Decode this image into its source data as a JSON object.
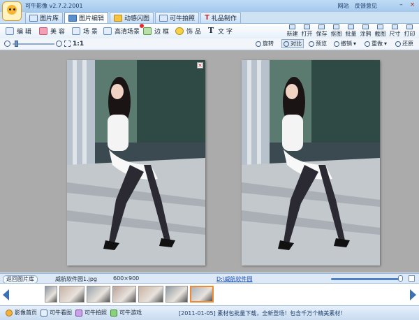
{
  "app": {
    "title": "可牛影像 v2.7.2.2001"
  },
  "header_links": [
    "网站",
    "反馈意见"
  ],
  "window_buttons": {
    "minimize": "–",
    "close": "×"
  },
  "tabs": [
    {
      "label": "图片库",
      "icon": "gallery-icon"
    },
    {
      "label": "图片编辑",
      "icon": "edit-icon",
      "active": true
    },
    {
      "label": "动感闪图",
      "icon": "flash-icon"
    },
    {
      "label": "可牛拍照",
      "icon": "camera-icon"
    },
    {
      "label": "礼品制作",
      "icon": "gift-icon"
    }
  ],
  "tools": [
    {
      "label": "编 辑",
      "icon": "edit-icon"
    },
    {
      "label": "美 容",
      "icon": "beauty-icon"
    },
    {
      "label": "场 景",
      "icon": "scene-icon"
    },
    {
      "label": "高清场景",
      "icon": "hd-scene-icon",
      "badge": true
    },
    {
      "label": "边 框",
      "icon": "frame-icon"
    },
    {
      "label": "饰 品",
      "icon": "ornament-icon"
    },
    {
      "label": "文 字",
      "icon": "text-icon"
    }
  ],
  "right_tools": [
    "新建",
    "打开",
    "保存",
    "抠图",
    "批量",
    "涂鸦",
    "截图",
    "尺寸",
    "打印"
  ],
  "view_bar": {
    "zoom_label": "1:1",
    "zoom_level": 0.05,
    "rotate": "旋转",
    "compare": "对比",
    "preview": "预览",
    "undo": "撤销",
    "redo": "重做",
    "restore": "还原"
  },
  "info": {
    "back_button": "返回图片库",
    "file_name": "威航软件园1.jpg",
    "image_size": "600×900",
    "folder_path": "D:\\威航软件园",
    "volume_level": 0.99
  },
  "filmstrip": {
    "thumb_count": 7,
    "selected_index": 6
  },
  "status": {
    "links": [
      {
        "label": "影像首页",
        "icon": "home-icon"
      },
      {
        "label": "可牛看图",
        "icon": "viewer-icon"
      },
      {
        "label": "可牛拍照",
        "icon": "camera-icon"
      },
      {
        "label": "可牛游戏",
        "icon": "game-icon"
      }
    ],
    "notice": "[2011-01-05] 素材包批量下载，全新登场！包含千万个精美素材！"
  },
  "colors": {
    "accent": "#3c6fb3",
    "workspace": "#ababab",
    "selected_thumb": "#f08a30"
  }
}
